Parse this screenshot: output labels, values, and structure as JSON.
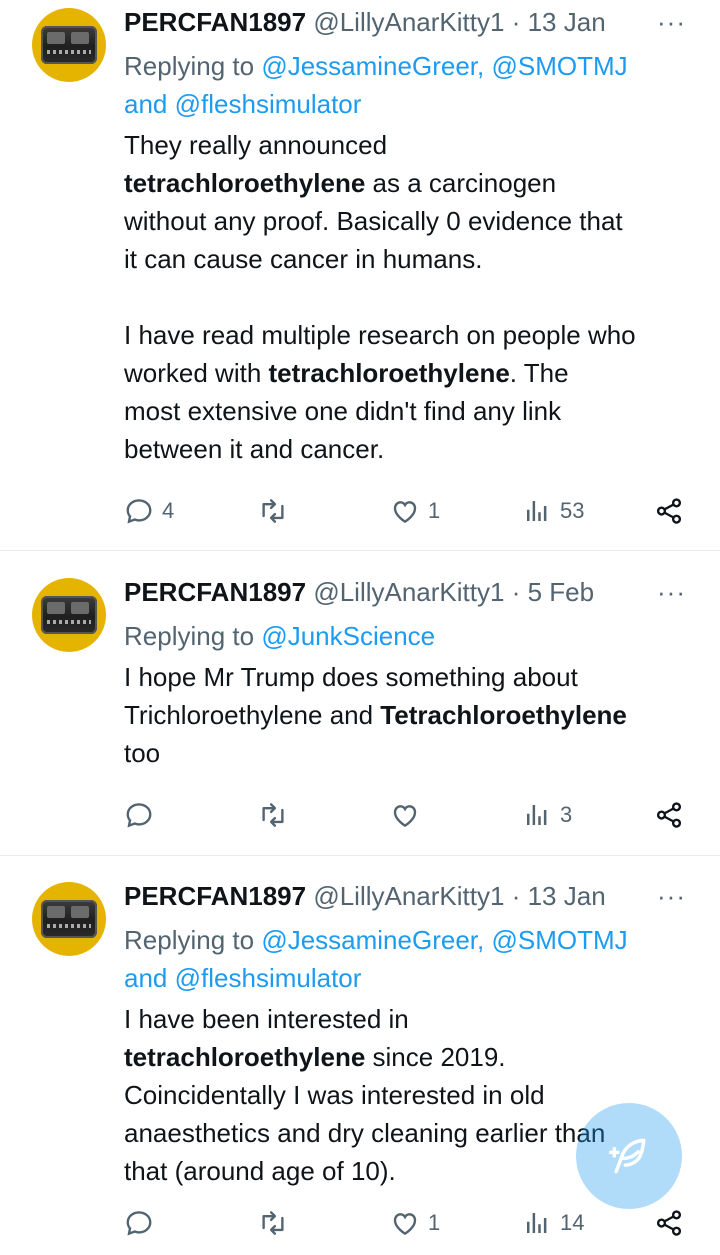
{
  "tweets": [
    {
      "name": "PERCFAN1897",
      "handle": "@LillyAnarKitty1",
      "dot": "·",
      "date": "13 Jan",
      "more": "···",
      "reply_prefix": "Replying to",
      "reply_links": [
        "@JessamineGreer",
        "@SMOTMJ"
      ],
      "reply_sep": ",",
      "reply_and": "and",
      "reply_last": "@fleshsimulator",
      "body": {
        "p1a": "They really announced",
        "p1b": "tetrachloroethylene",
        "p1c": " as a carcinogen",
        "p1d": "without any proof. Basically 0 evidence that",
        "p1e": "it can cause cancer in humans.",
        "p2a": "I have read multiple research on people who",
        "p2b": "worked with ",
        "p2c": "tetrachloroethylene",
        "p2d": ". The",
        "p2e": "most extensive one didn't find any link",
        "p2f": "between it and cancer."
      },
      "counts": {
        "replies": "4",
        "retweets": "",
        "likes": "1",
        "views": "53"
      }
    },
    {
      "name": "PERCFAN1897",
      "handle": "@LillyAnarKitty1",
      "dot": "·",
      "date": "5 Feb",
      "more": "···",
      "reply_prefix": "Replying to",
      "reply_links": [
        "@JunkScience"
      ],
      "body": {
        "l1": "I hope Mr Trump does something about",
        "l2a": "Trichloroethylene and ",
        "l2b": "Tetrachloroethylene",
        "l3": "too"
      },
      "counts": {
        "replies": "",
        "retweets": "",
        "likes": "",
        "views": "3"
      }
    },
    {
      "name": "PERCFAN1897",
      "handle": "@LillyAnarKitty1",
      "dot": "·",
      "date": "13 Jan",
      "more": "···",
      "reply_prefix": "Replying to",
      "reply_links": [
        "@JessamineGreer",
        "@SMOTMJ"
      ],
      "reply_sep": ",",
      "reply_and": "and",
      "reply_last": "@fleshsimulator",
      "body": {
        "l1": "I have been interested in",
        "l2a": "tetrachloroethylene",
        "l2b": " since 2019.",
        "l3": "Coincidentally I was interested in old",
        "l4": "anaesthetics and dry cleaning earlier than",
        "l5": "that (around age of 10)."
      },
      "counts": {
        "replies": "",
        "retweets": "",
        "likes": "1",
        "views": "14"
      }
    }
  ],
  "colors": {
    "accent": "#1d9bf0",
    "muted": "#536471",
    "text": "#0f1419"
  },
  "icons": [
    "reply-icon",
    "retweet-icon",
    "like-icon",
    "views-icon",
    "share-icon",
    "compose-icon",
    "more-icon"
  ]
}
